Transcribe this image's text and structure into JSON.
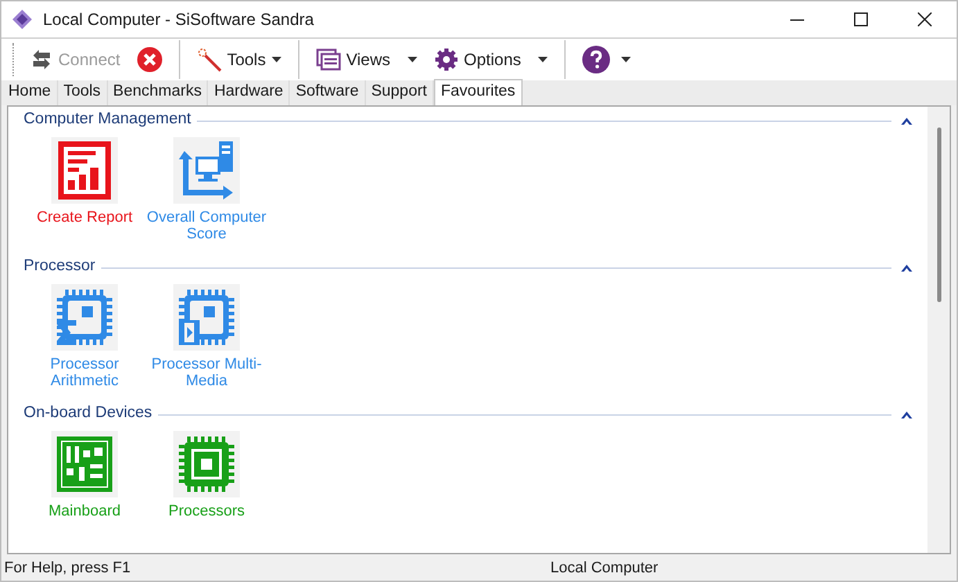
{
  "window": {
    "title": "Local Computer - SiSoftware Sandra"
  },
  "toolbar": {
    "connect": {
      "label": "Connect",
      "disabled": true
    },
    "tools": {
      "label": "Tools"
    },
    "views": {
      "label": "Views"
    },
    "options": {
      "label": "Options"
    }
  },
  "tabs": [
    {
      "label": "Home",
      "selected": false
    },
    {
      "label": "Tools",
      "selected": false
    },
    {
      "label": "Benchmarks",
      "selected": false
    },
    {
      "label": "Hardware",
      "selected": false
    },
    {
      "label": "Software",
      "selected": false
    },
    {
      "label": "Support",
      "selected": false
    },
    {
      "label": "Favourites",
      "selected": true
    }
  ],
  "groups": [
    {
      "title": "Computer Management",
      "expanded": true,
      "items": [
        {
          "kind": "report",
          "label": "Create Report",
          "color": "#e8141b"
        },
        {
          "kind": "score",
          "label": "Overall Computer Score",
          "color": "#2f8ae6"
        }
      ]
    },
    {
      "title": "Processor",
      "expanded": true,
      "items": [
        {
          "kind": "cpu-sigma",
          "label": "Processor Arithmetic",
          "color": "#2f8ae6"
        },
        {
          "kind": "cpu-film",
          "label": "Processor Multi-Media",
          "color": "#2f8ae6"
        }
      ]
    },
    {
      "title": "On-board Devices",
      "expanded": true,
      "items": [
        {
          "kind": "board",
          "label": "Mainboard",
          "color": "#18a018"
        },
        {
          "kind": "chip",
          "label": "Processors",
          "color": "#18a018"
        }
      ]
    }
  ],
  "status_bar": {
    "help": "For Help, press F1",
    "computer": "Local Computer"
  }
}
